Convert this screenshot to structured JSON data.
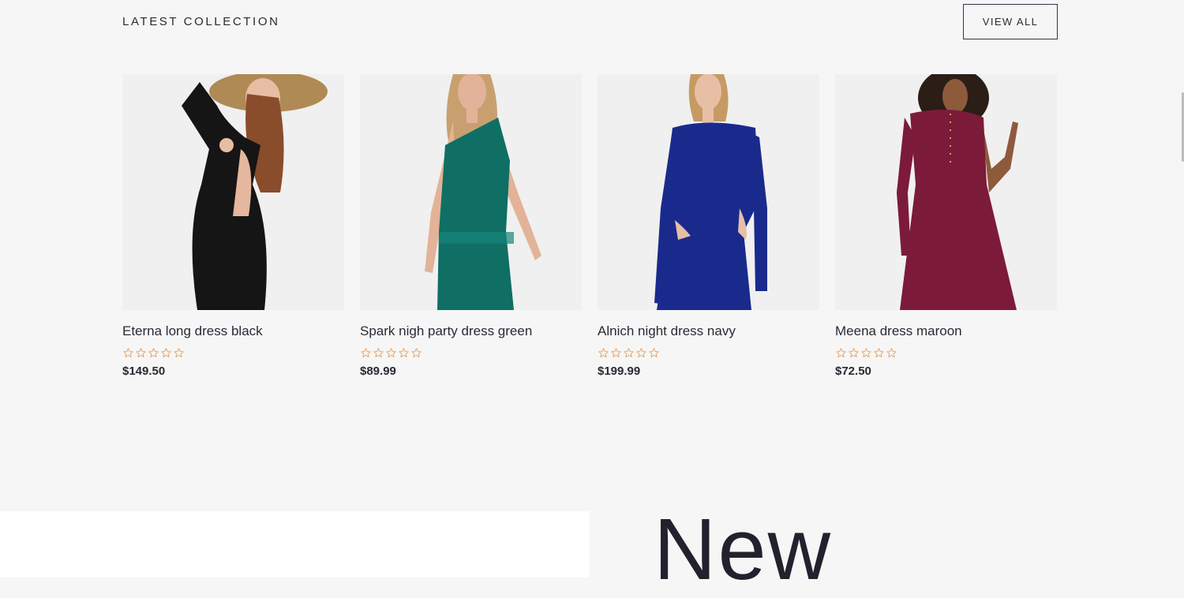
{
  "section": {
    "title": "LATEST COLLECTION",
    "view_all_label": "VIEW ALL"
  },
  "products": [
    {
      "name": "Eterna long dress black",
      "price": "$149.50",
      "rating": 0,
      "max_rating": 5,
      "dress_color": "#151515"
    },
    {
      "name": "Spark nigh party dress green",
      "price": "$89.99",
      "rating": 0,
      "max_rating": 5,
      "dress_color": "#0f6f64"
    },
    {
      "name": "Alnich night dress navy",
      "price": "$199.99",
      "rating": 0,
      "max_rating": 5,
      "dress_color": "#1a2a8c"
    },
    {
      "name": "Meena dress maroon",
      "price": "$72.50",
      "rating": 0,
      "max_rating": 5,
      "dress_color": "#7c1a3a"
    }
  ],
  "banner": {
    "heading": "New"
  },
  "colors": {
    "background": "#f6f6f6",
    "star": "#e8a465",
    "text": "#2a2a33"
  }
}
